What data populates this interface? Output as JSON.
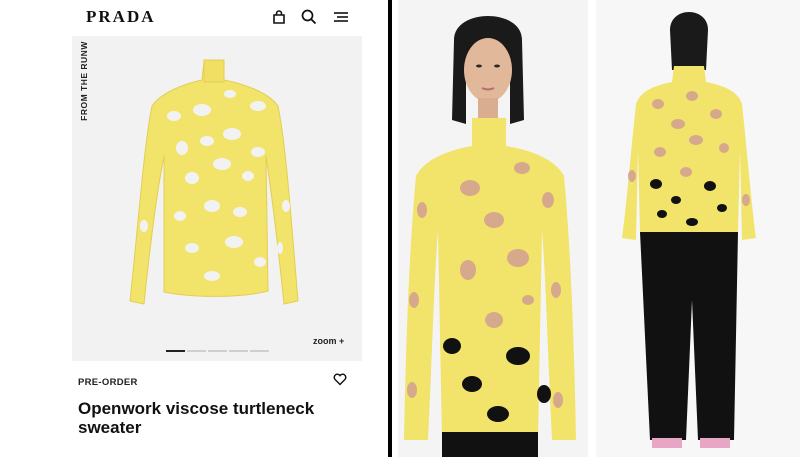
{
  "brand": {
    "logo": "PRADA"
  },
  "header": {
    "icons": [
      "bag-icon",
      "search-icon",
      "menu-icon"
    ]
  },
  "gallery": {
    "vertical_label": "FROM THE RUNW",
    "zoom_label": "zoom +",
    "pagination": {
      "total": 5,
      "active": 1
    }
  },
  "product": {
    "status": "PRE-ORDER",
    "title": "Openwork viscose turtleneck sweater",
    "wishlist_icon": "heart-icon"
  },
  "colors": {
    "sweater": "#f2e36b",
    "sweater_shade": "#e4d25a",
    "skin": "#d6a98c",
    "pants": "#111111"
  }
}
